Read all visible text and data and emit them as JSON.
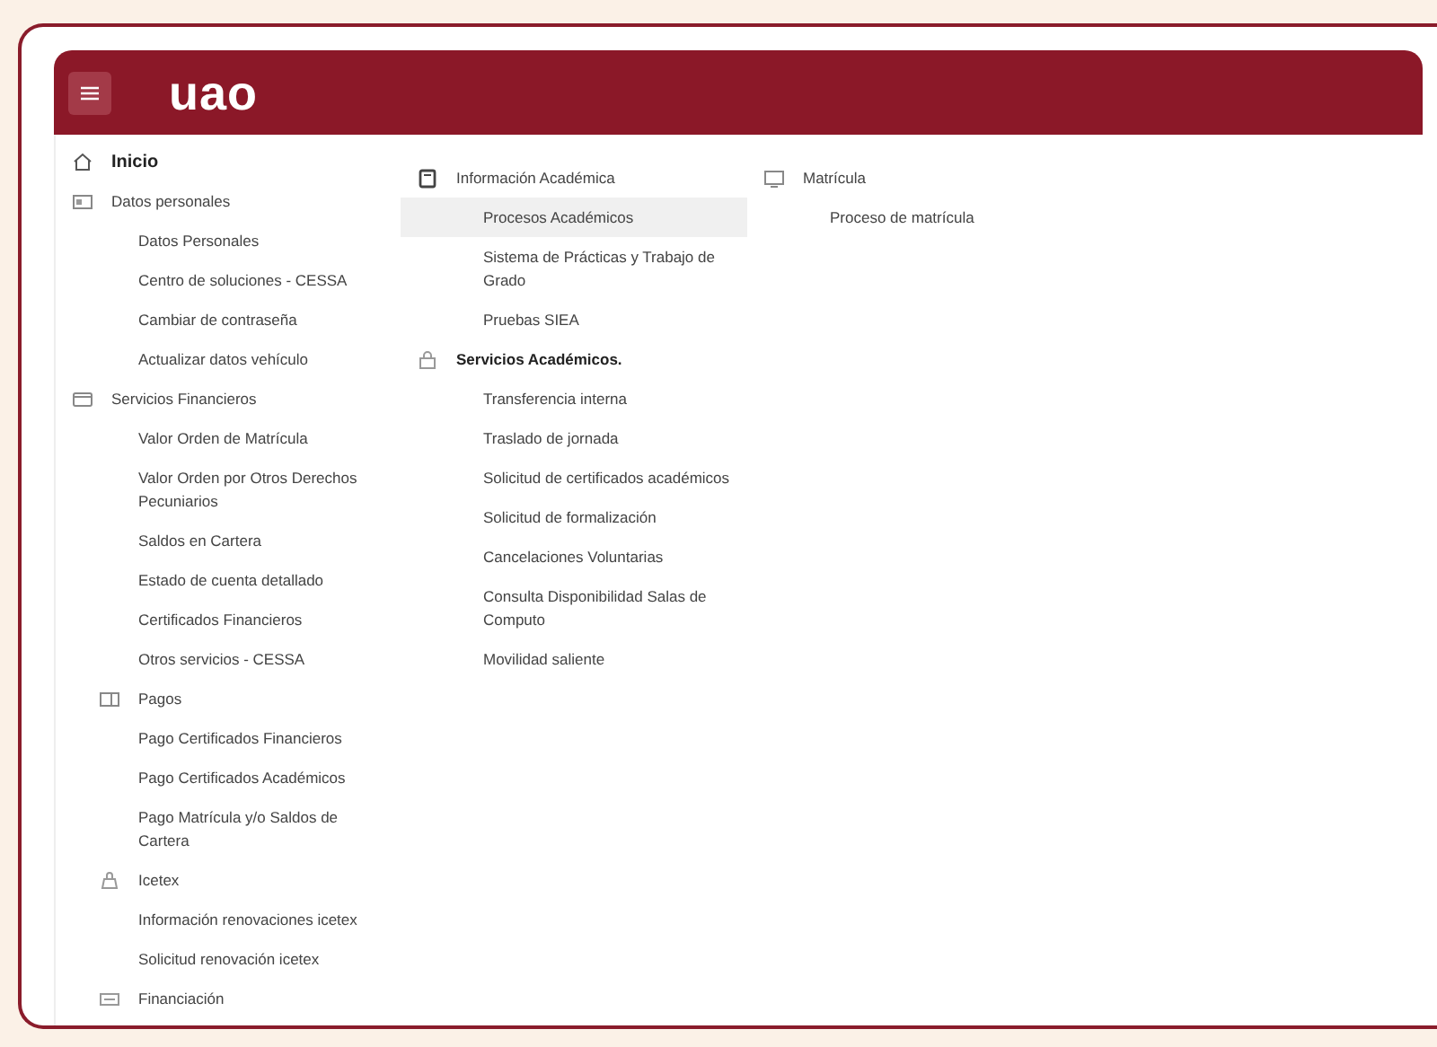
{
  "header": {
    "logo": "uao"
  },
  "columns": [
    [
      {
        "kind": "section",
        "label": "Inicio",
        "bold": true,
        "selected": false
      },
      {
        "kind": "section",
        "label": "Datos personales",
        "bold": false,
        "selected": false,
        "children": [
          {
            "kind": "link",
            "label": "Datos Personales",
            "selected": false
          },
          {
            "kind": "link",
            "label": "Centro de soluciones - CESSA",
            "selected": false
          },
          {
            "kind": "link",
            "label": "Cambiar de contraseña",
            "selected": false
          },
          {
            "kind": "link",
            "label": "Actualizar datos vehículo",
            "selected": false
          }
        ]
      },
      {
        "kind": "section",
        "label": "Servicios Financieros",
        "bold": false,
        "selected": false,
        "children": [
          {
            "kind": "link",
            "label": "Valor Orden de Matrícula",
            "selected": false
          },
          {
            "kind": "link",
            "label": "Valor Orden por Otros Derechos Pecuniarios",
            "selected": false
          },
          {
            "kind": "link",
            "label": "Saldos en Cartera",
            "selected": false
          },
          {
            "kind": "link",
            "label": "Estado de cuenta detallado",
            "selected": false
          },
          {
            "kind": "link",
            "label": "Certificados Financieros",
            "selected": false
          },
          {
            "kind": "link",
            "label": "Otros servicios - CESSA",
            "selected": false
          },
          {
            "kind": "section",
            "label": "Pagos",
            "bold": false,
            "selected": false,
            "children": [
              {
                "kind": "link",
                "label": "Pago Certificados Financieros",
                "selected": false
              },
              {
                "kind": "link",
                "label": "Pago Certificados Académicos",
                "selected": false
              },
              {
                "kind": "link",
                "label": "Pago Matrícula y/o Saldos de Cartera",
                "selected": false
              }
            ]
          },
          {
            "kind": "section",
            "label": "Icetex",
            "bold": false,
            "selected": false,
            "children": [
              {
                "kind": "link",
                "label": "Información renovaciones icetex",
                "selected": false
              },
              {
                "kind": "link",
                "label": "Solicitud renovación icetex",
                "selected": false
              }
            ]
          },
          {
            "kind": "section",
            "label": "Financiación",
            "bold": false,
            "selected": false
          }
        ]
      }
    ],
    [
      {
        "kind": "section",
        "label": "Información Académica",
        "bold": false,
        "selected": false,
        "children": [
          {
            "kind": "link",
            "label": "Procesos Académicos",
            "selected": true
          },
          {
            "kind": "link",
            "label": "Sistema de Prácticas y Trabajo de Grado",
            "selected": false
          },
          {
            "kind": "link",
            "label": "Pruebas SIEA",
            "selected": false
          }
        ]
      },
      {
        "kind": "section",
        "label": "Servicios Académicos.",
        "bold": true,
        "selected": false,
        "children": [
          {
            "kind": "link",
            "label": "Transferencia interna",
            "selected": false
          },
          {
            "kind": "link",
            "label": "Traslado de jornada",
            "selected": false
          },
          {
            "kind": "link",
            "label": "Solicitud de certificados académicos",
            "selected": false
          },
          {
            "kind": "link",
            "label": "Solicitud de formalización",
            "selected": false
          },
          {
            "kind": "link",
            "label": "Cancelaciones Voluntarias",
            "selected": false
          },
          {
            "kind": "link",
            "label": "Consulta Disponibilidad Salas de Computo",
            "selected": false
          },
          {
            "kind": "link",
            "label": "Movilidad saliente",
            "selected": false
          }
        ]
      }
    ],
    [
      {
        "kind": "section",
        "label": "Matrícula",
        "bold": false,
        "selected": false,
        "children": [
          {
            "kind": "link",
            "label": "Proceso de matrícula",
            "selected": false
          }
        ]
      }
    ]
  ]
}
